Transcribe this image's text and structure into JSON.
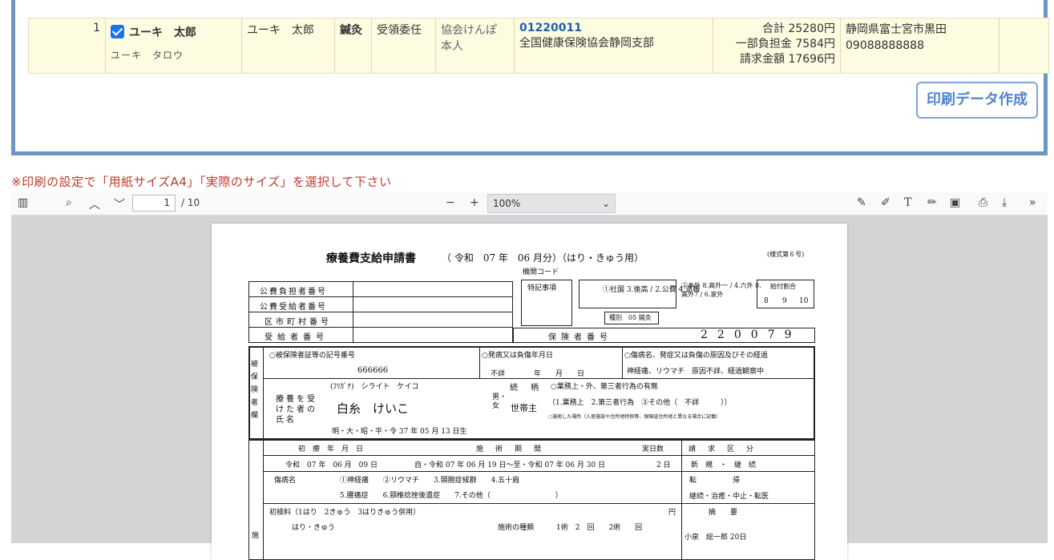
{
  "record": {
    "no": "1",
    "name_kanji": "ユーキ　太郎",
    "name_kana": "ユーキ　タロウ",
    "patient_name": "ユーキ　太郎",
    "treatment": "鍼灸",
    "receipt": "受領委任",
    "insurer_type": "協会けんぽ",
    "insured_rel": "本人",
    "insurer_no": "01220011",
    "insurer_name": "全国健康保険協会静岡支部",
    "total": "合計 25280円",
    "copay": "一部負担金 7584円",
    "claim": "請求金額 17696円",
    "address": "静岡県富士宮市黒田",
    "phone": "09088888888"
  },
  "print_button": "印刷データ作成",
  "notice": "※印刷の設定で「用紙サイズA4」「実際のサイズ」を選択して下さい",
  "viewer": {
    "page_current": "1",
    "page_total": "/ 10",
    "zoom": "100%"
  },
  "form": {
    "title": "療養費支給申請書",
    "period": "（ 令和　07 年　06 月分）（はり・きゅう用）",
    "form_no": "(様式第６号)",
    "org_code": "機関コード",
    "labels": [
      "公費負担者番号",
      "公費受給者番号",
      "区市町村番号",
      "受給者番号"
    ],
    "tokki": "特記事項",
    "ins_types": "①社国 3.後高 / 2.公費 4.退職",
    "ins_types2": "②本外 8.高外一 / 4.六外 0.高外7 / 6.家外",
    "kyufu": "給付割合",
    "kyufu_vals": [
      "8",
      "9",
      "10"
    ],
    "shubetsu": "種別　05 鍼灸",
    "hokensha_label": "保険者番号",
    "hokensha_digits": [
      "2",
      "2",
      "0",
      "0",
      "7",
      "9"
    ],
    "kigou_label": "○被保険者証等の記号番号",
    "kigou_val": "666666",
    "onset_label": "○発病又は負傷年月日",
    "onset_val": "不詳　　　　年　　月　　日",
    "cause_label": "○傷病名、発症又は負傷の原因及びその経過",
    "cause_val": "神経痛、リウマチ　原因不詳、経過観察中",
    "side_label": "被保険者欄",
    "furigana_label": "(ﾌﾘｶﾞﾅ)　シライト　ケイコ",
    "patient_label": "療養を受けた者の氏名",
    "patient_name": "白糸　けいこ",
    "sex": "男・女",
    "zokugara": "続　柄",
    "setainushi": "世帯主",
    "gyomu_label": "○業務上・外、第三者行為の有無",
    "gyomu_val": "（1.業務上　2.第三者行為　③その他（　不詳　　　））",
    "shisetsu": "○施術した場所（入居施設や住所地特例等、保険証住所地と異なる場合に記載）",
    "birth": "明・大・昭・平・令 37 年 05 月 13 日生",
    "first_label": "初　療　年　月　日",
    "first_val": "令和　07 年　06 月　09 日",
    "period_label": "施　術　期　間",
    "period_val": "自・令和 07 年 06 月 19 日〜至・令和 07 年 06 月 30 日",
    "days_label": "実日数",
    "days_val": "2 日",
    "seikyu_label": "請　求　区　分",
    "seikyu_val": "新　規　・　継　続",
    "tenki": "転　　　　　帰",
    "tenki_val": "継続・治癒・中止・転医",
    "disease_label": "傷病名",
    "disease_row1": "①神経痛　　②リウマチ　　3.頸腕症候群　　4.五十肩",
    "disease_row2": "5.腰痛症　　6.頸椎捻挫後遺症　　7.その他（　　　　　　　　　）",
    "shoken": "初検料（1はり　2きゅう　3はりきゅう併用）",
    "yen": "円",
    "tekiyo": "摘　　要",
    "hari": "はり・きゅう",
    "shujutsu": "施術の種類",
    "shujutsu_vals": "1術　2　回　　2術　　回",
    "tekiyo_val": "小泉　総一郎 20日",
    "side2": "施"
  }
}
